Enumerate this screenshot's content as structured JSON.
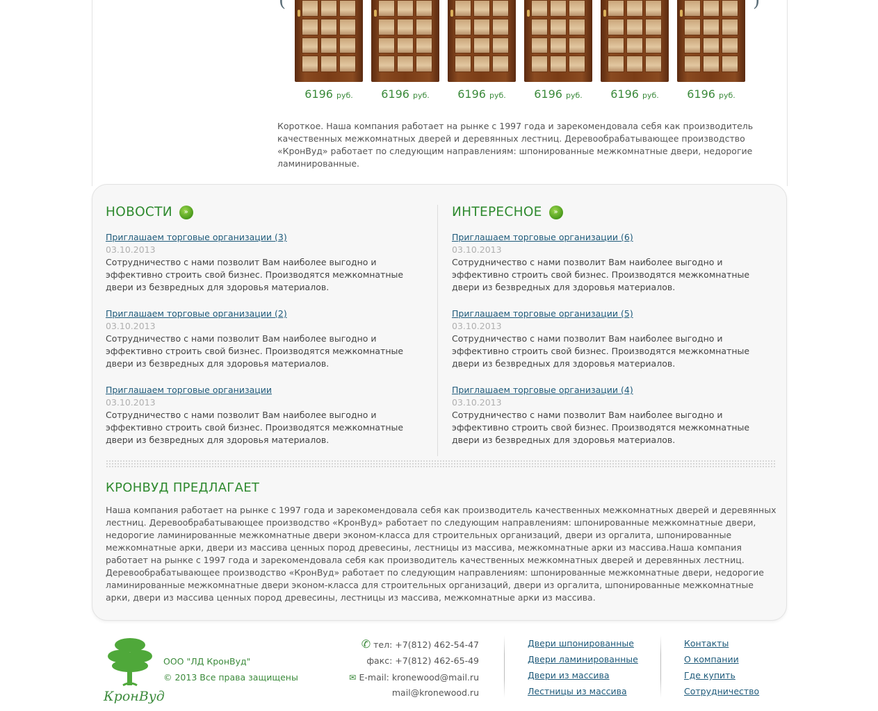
{
  "carousel": {
    "prev_arrow": "(",
    "next_arrow": ")",
    "products": [
      {
        "price": "6196",
        "currency": "руб."
      },
      {
        "price": "6196",
        "currency": "руб."
      },
      {
        "price": "6196",
        "currency": "руб."
      },
      {
        "price": "6196",
        "currency": "руб."
      },
      {
        "price": "6196",
        "currency": "руб."
      },
      {
        "price": "6196",
        "currency": "руб."
      }
    ]
  },
  "intro_text": "Короткое. Наша компания работает на рынке с 1997 года и зарекомендовала себя как производитель качественных межкомнатных дверей и деревянных лестниц. Деревообрабатывающее производство «КронВуд» работает по следующим направлениям: шпонированные межкомнатные двери, недорогие ламинированные.",
  "news": {
    "title": "НОВОСТИ",
    "items": [
      {
        "title": "Приглашаем торговые организации (3)",
        "date": "03.10.2013",
        "text": "Сотрудничество с нами позволит Вам наиболее выгодно и эффективно строить свой бизнес. Производятся межкомнатные двери из безвредных для здоровья материалов."
      },
      {
        "title": "Приглашаем торговые организации (2)",
        "date": "03.10.2013",
        "text": "Сотрудничество с нами позволит Вам наиболее выгодно и эффективно строить свой бизнес. Производятся межкомнатные двери из безвредных для здоровья материалов."
      },
      {
        "title": "Приглашаем торговые организации",
        "date": "03.10.2013",
        "text": "Сотрудничество с нами позволит Вам наиболее выгодно и эффективно строить свой бизнес. Производятся межкомнатные двери из безвредных для здоровья материалов."
      }
    ]
  },
  "interesting": {
    "title": "ИНТЕРЕСНОЕ",
    "items": [
      {
        "title": "Приглашаем торговые организации (6)",
        "date": "03.10.2013",
        "text": "Сотрудничество с нами позволит Вам наиболее выгодно и эффективно строить свой бизнес. Производятся межкомнатные двери из безвредных для здоровья материалов."
      },
      {
        "title": "Приглашаем торговые организации (5)",
        "date": "03.10.2013",
        "text": "Сотрудничество с нами позволит Вам наиболее выгодно и эффективно строить свой бизнес. Производятся межкомнатные двери из безвредных для здоровья материалов."
      },
      {
        "title": "Приглашаем торговые организации (4)",
        "date": "03.10.2013",
        "text": "Сотрудничество с нами позволит Вам наиболее выгодно и эффективно строить свой бизнес. Производятся межкомнатные двери из безвредных для здоровья материалов."
      }
    ]
  },
  "offer": {
    "title": "КРОНВУД ПРЕДЛАГАЕТ",
    "text": "Наша компания работает на рынке с 1997 года и зарекомендовала себя как производитель качественных межкомнатных дверей и деревянных лестниц. Деревообрабатывающее производство «КронВуд» работает по следующим направлениям: шпонированные межкомнатные двери, недорогие ламинированные межкомнатные двери эконом-класса для строительных организаций, двери из оргалита, шпонированные межкомнатные арки, двери из массива ценных пород древесины, лестницы из массива, межкомнатные арки из массива.Наша компания работает на рынке с 1997 года и зарекомендовала себя как производитель качественных межкомнатных дверей и деревянных лестниц. Деревообрабатывающее производство «КронВуд» работает по следующим направлениям: шпонированные межкомнатные двери, недорогие ламинированные межкомнатные двери эконом-класса для строительных организаций, двери из оргалита, шпонированные межкомнатные арки, двери из массива ценных пород древесины, лестницы из массива, межкомнатные арки из массива."
  },
  "footer": {
    "logo_text": "КронВуд",
    "company_name": "ООО \"ЛД КронВуд\"",
    "copyright": "© 2013 Все права защищены",
    "phone": "тел: +7(812) 462-54-47",
    "fax": "факс: +7(812) 462-65-49",
    "email1": "E-mail: kronewood@mail.ru",
    "email2": "mail@kronewood.ru",
    "catalog_links": [
      "Двери шпонированные",
      "Двери ламинированные",
      "Двери из массива",
      "Лестницы из массива"
    ],
    "info_links": [
      "Контакты",
      "О компании",
      "Где купить",
      "Сотрудничество"
    ]
  },
  "colors": {
    "accent_green": "#2f8a2f",
    "link_blue": "#1e5a7a"
  }
}
